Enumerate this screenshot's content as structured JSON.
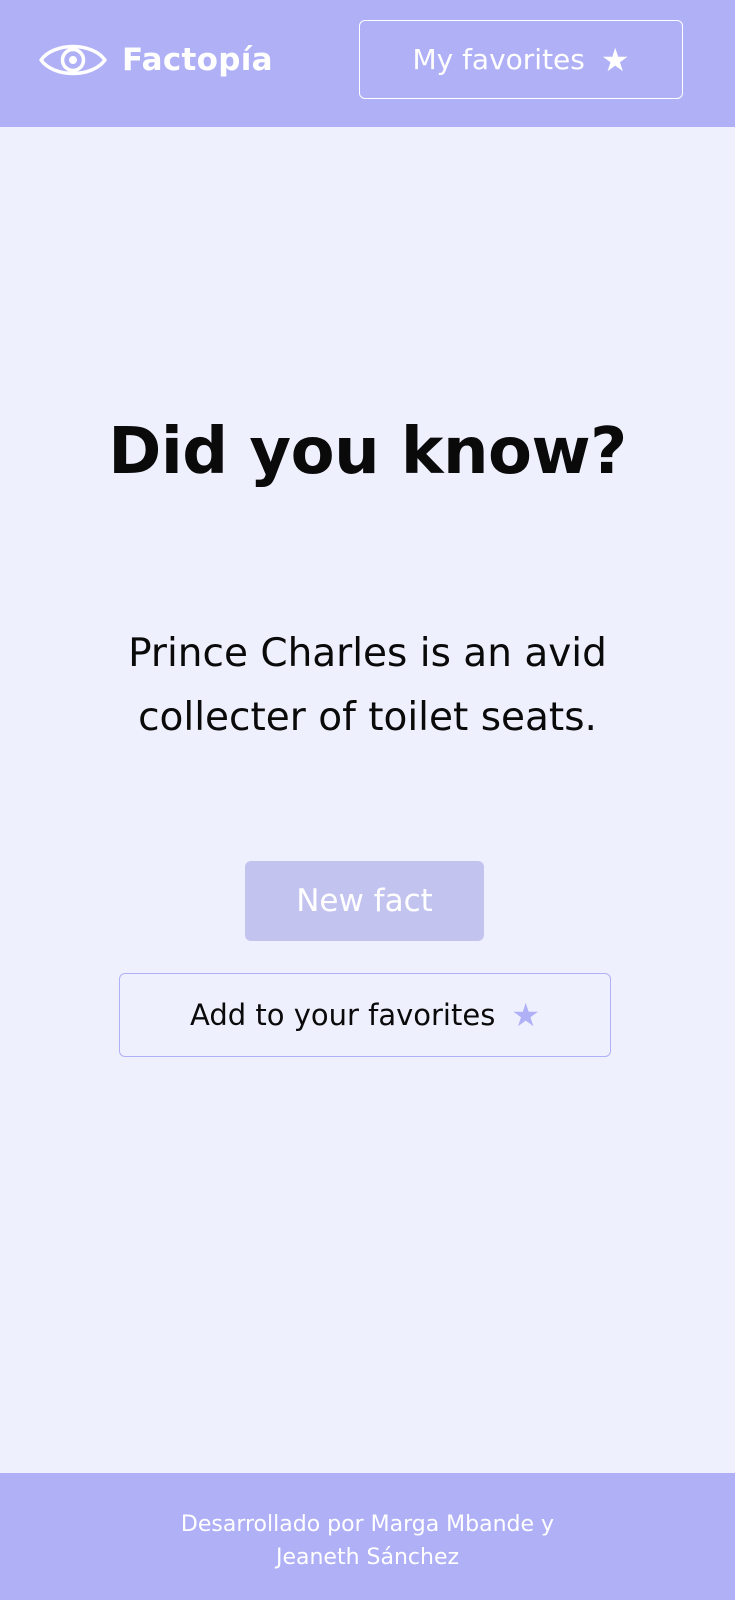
{
  "header": {
    "brand_name": "Factopía",
    "favorites_button_label": "My favorites",
    "favorites_icon": "star-icon",
    "logo_icon": "eye-icon"
  },
  "main": {
    "title": "Did you know?",
    "fact_text": "Prince Charles is an avid collecter of toilet seats.",
    "new_fact_label": "New fact",
    "add_favorites_label": "Add to your favorites",
    "add_favorites_icon": "star-icon"
  },
  "footer": {
    "credit_line_1": "Desarrollado por Marga Mbande y",
    "credit_line_2": "Jeaneth Sánchez"
  },
  "colors": {
    "primary": "#b0b0f7",
    "background": "#eff0fd",
    "button_muted": "#c3c3f0",
    "text": "#0a0a0a"
  }
}
